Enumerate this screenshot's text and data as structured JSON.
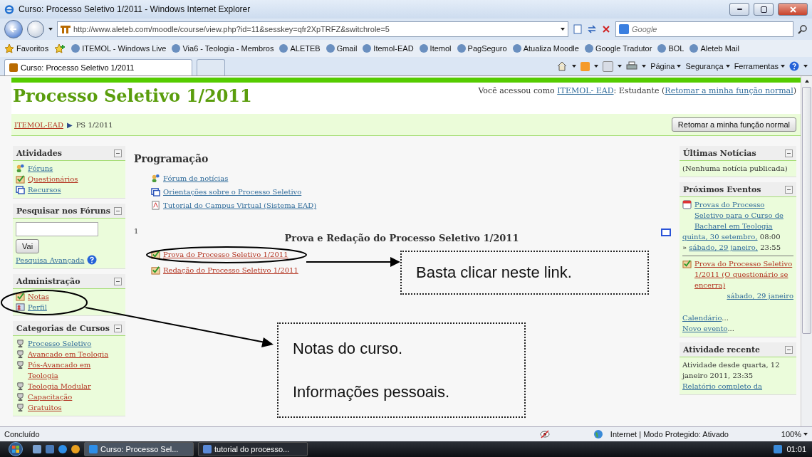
{
  "window": {
    "title": "Curso: Processo Seletivo 1/2011 - Windows Internet Explorer"
  },
  "address_bar": {
    "url": "http://www.aleteb.com/moodle/course/view.php?id=11&sesskey=qfr2XpTRFZ&switchrole=5",
    "search_placeholder": "Google"
  },
  "favorites": {
    "label": "Favoritos",
    "items": [
      "ITEMOL - Windows Live",
      "Via6 - Teologia - Membros",
      "ALETEB",
      "Gmail",
      "Itemol-EAD",
      "Itemol",
      "PagSeguro",
      "Atualiza Moodle",
      "Google Tradutor",
      "BOL",
      "Aleteb Mail"
    ]
  },
  "tabs": [
    {
      "label": "Curso: Processo Seletivo 1/2011",
      "selected": true
    }
  ],
  "command_menus": [
    "Página",
    "Segurança",
    "Ferramentas"
  ],
  "page": {
    "title": "Processo Seletivo 1/2011",
    "login": {
      "prefix": "Você acessou como",
      "user": "ITEMOL- EAD",
      "middle": ": Estudante (",
      "link": "Retomar a minha função normal",
      "suffix": ")"
    },
    "breadcrumb": {
      "parent": "ITEMOL-EAD",
      "separator": "▶",
      "current": "PS 1/2011"
    },
    "role_button": "Retomar a minha função normal",
    "left_blocks": [
      {
        "title": "Atividades",
        "kind": "links",
        "items": [
          {
            "label": "Fóruns",
            "kind": "forum",
            "visited": false
          },
          {
            "label": "Questionários",
            "kind": "quiz",
            "visited": true
          },
          {
            "label": "Recursos",
            "kind": "resource",
            "visited": false
          }
        ]
      },
      {
        "title": "Pesquisar nos Fóruns",
        "kind": "search",
        "button": "Vai",
        "link": "Pesquisa Avançada"
      },
      {
        "title": "Administração",
        "kind": "links",
        "items": [
          {
            "label": "Notas",
            "kind": "quiz",
            "visited": true
          },
          {
            "label": "Perfil",
            "kind": "profile",
            "visited": false
          }
        ]
      },
      {
        "title": "Categorias de Cursos",
        "kind": "links",
        "items": [
          {
            "label": "Processo Seletivo",
            "kind": "category",
            "visited": false
          },
          {
            "label": "Avancado em Teologia",
            "kind": "category",
            "visited": true
          },
          {
            "label": "Pós-Avancado em Teologia",
            "kind": "category",
            "visited": true
          },
          {
            "label": "Teologia Modular",
            "kind": "category",
            "visited": true
          },
          {
            "label": "Capacitação",
            "kind": "category",
            "visited": true
          },
          {
            "label": "Gratuitos",
            "kind": "category",
            "visited": true
          }
        ]
      }
    ],
    "center": {
      "section_title": "Programação",
      "items": [
        {
          "label": "Fórum de notícias",
          "kind": "forum",
          "visited": false
        },
        {
          "label": "Orientações sobre o Processo Seletivo",
          "kind": "resource",
          "visited": false
        },
        {
          "label": "Tutorial do Campus Virtual (Sistema EAD)",
          "kind": "file",
          "visited": false
        }
      ],
      "topic": {
        "number": "1",
        "title": "Prova e Redação do Processo Seletivo 1/2011",
        "items": [
          {
            "label": "Prova do Processo Seletivo 1/2011",
            "kind": "quiz",
            "visited": true
          },
          {
            "label": "Redação do Processo Seletivo 1/2011",
            "kind": "quiz",
            "visited": true
          }
        ]
      }
    },
    "right_blocks": [
      {
        "title": "Últimas Notícias",
        "kind": "text",
        "text": "(Nenhuma notícia publicada)"
      },
      {
        "title": "Próximos Eventos",
        "kind": "events",
        "events": [
          {
            "title": "Provas do Processo Seletivo para o Curso de Bacharel em Teologia",
            "kind": "calendar",
            "visited": false,
            "start_date": "quinta, 30 setembro,",
            "start_time": "08:00",
            "separator": "»",
            "end_date": "sábado, 29 janeiro,",
            "end_time": "23:55"
          },
          {
            "title": "Prova do Processo Seletivo 1/2011 (O questionário se encerra)",
            "kind": "quiz",
            "visited": true,
            "end_date": "sábado, 29 janeiro"
          }
        ],
        "links": [
          {
            "label": "Calendário",
            "after": "..."
          },
          {
            "label": "Novo evento",
            "after": "..."
          }
        ]
      },
      {
        "title": "Atividade recente",
        "kind": "recent",
        "text": "Atividade desde quarta, 12 janeiro 2011, 23:35",
        "link": "Relatório completo da"
      }
    ]
  },
  "annotations": [
    {
      "lines": [
        "Basta clicar neste link."
      ]
    },
    {
      "lines": [
        "Notas do curso.",
        "Informações pessoais."
      ]
    }
  ],
  "status_bar": {
    "text": "Concluído",
    "zone": "Internet | Modo Protegido: Ativado",
    "zoom": "100%"
  },
  "taskbar": {
    "items": [
      {
        "label": "Curso: Processo Sel...",
        "selected": true
      },
      {
        "label": "tutorial do processo...",
        "selected": false
      }
    ],
    "clock": "01:01"
  }
}
